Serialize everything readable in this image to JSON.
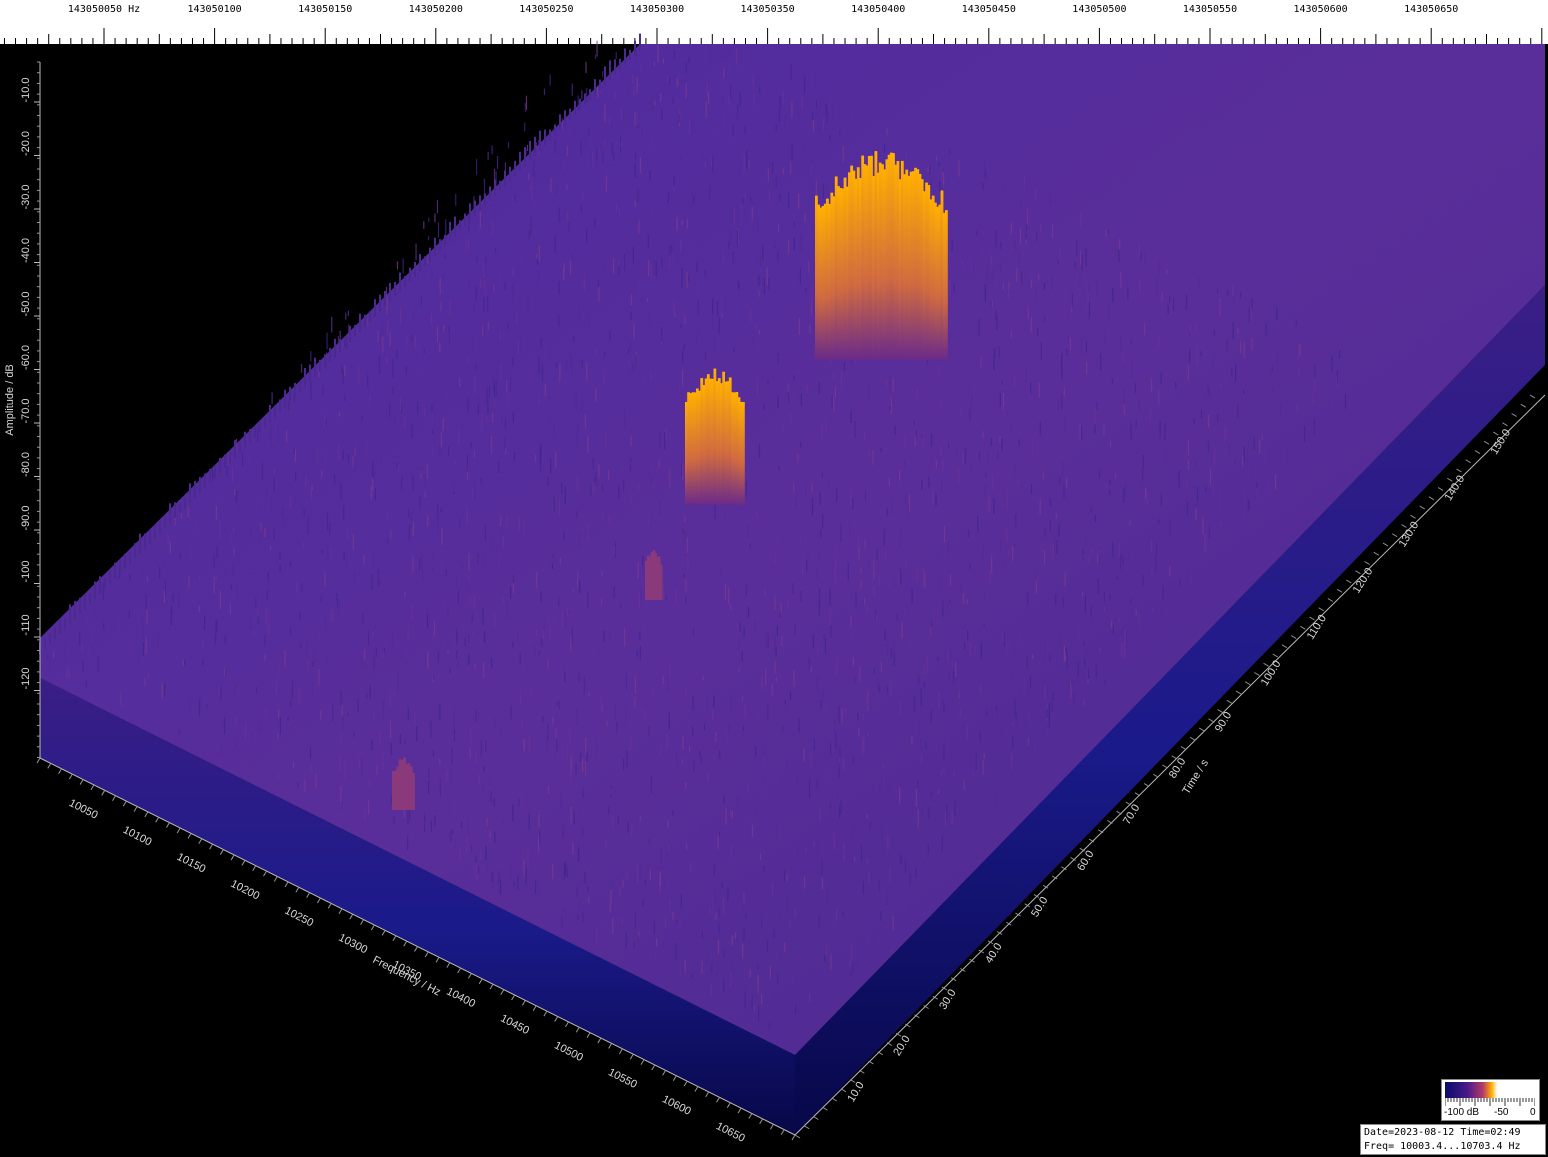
{
  "chart_data": {
    "type": "surface-3d-waterfall",
    "top_axis": {
      "labels": [
        "143050050 Hz",
        "143050100",
        "143050150",
        "143050200",
        "143050250",
        "143050300",
        "143050350",
        "143050400",
        "143050450",
        "143050500",
        "143050550",
        "143050600",
        "143050650"
      ]
    },
    "amplitude_axis": {
      "title": "Amplitude / dB",
      "labels": [
        "-10.0",
        "-20.0",
        "-30.0",
        "-40.0",
        "-50.0",
        "-60.0",
        "-70.0",
        "-80.0",
        "-90.0",
        "-100",
        "-110",
        "-120"
      ]
    },
    "frequency_axis": {
      "title": "Frequency / Hz",
      "labels": [
        "10050",
        "10100",
        "10150",
        "10200",
        "10250",
        "10300",
        "10350",
        "10400",
        "10450",
        "10500",
        "10550",
        "10600",
        "10650"
      ]
    },
    "time_axis": {
      "title": "Time / s",
      "labels": [
        "10.0",
        "20.0",
        "30.0",
        "40.0",
        "50.0",
        "60.0",
        "70.0",
        "80.0",
        "90.0",
        "100.0",
        "110.0",
        "120.0",
        "130.0",
        "140.0",
        "150.0"
      ]
    },
    "color_scale": {
      "min_label": "-100 dB",
      "mid_label": "-50",
      "max_label": "0",
      "colors": [
        "#0a0a6a",
        "#4a1a8a",
        "#b23a6a",
        "#ffb000",
        "#ffffff"
      ]
    },
    "signals": [
      {
        "freq": 10400,
        "time": 120,
        "peak_db": -20
      },
      {
        "freq": 10350,
        "time": 95,
        "peak_db": -60
      },
      {
        "freq": 10300,
        "time": 70,
        "peak_db": -95
      },
      {
        "freq": 10150,
        "time": 15,
        "peak_db": -105
      }
    ]
  },
  "info": {
    "line1": "Date=2023-08-12 Time=02:49",
    "line2": "Freq= 10003.4...10703.4 Hz"
  }
}
